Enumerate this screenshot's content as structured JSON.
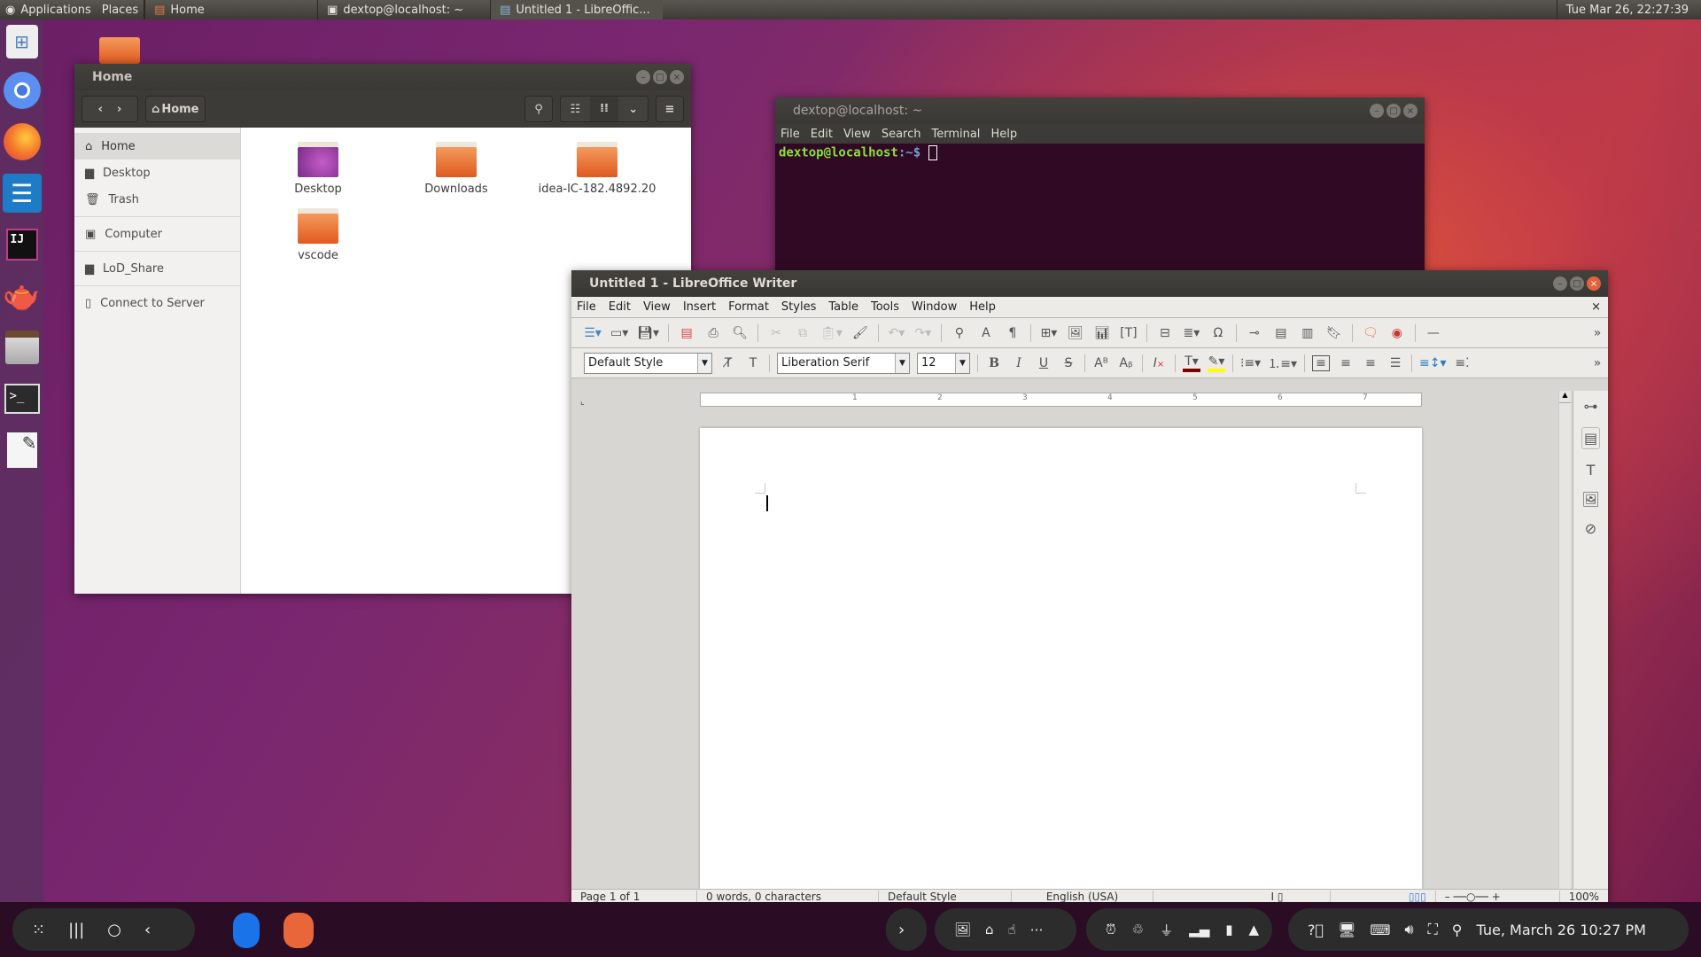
{
  "topbar": {
    "applications": "Applications",
    "places": "Places",
    "tasks": [
      {
        "label": "Home",
        "icon": "file-manager-icon"
      },
      {
        "label": "dextop@localhost: ~",
        "icon": "terminal-icon"
      },
      {
        "label": "Untitled 1 - LibreOffic...",
        "icon": "document-icon"
      }
    ],
    "clock": "Tue Mar 26, 22:27:39"
  },
  "launcher": [
    "software-center",
    "chromium",
    "firefox",
    "libreoffice-writer",
    "intellij-idea",
    "teapot-app",
    "file-cabinet",
    "terminal",
    "text-editor"
  ],
  "nautilus": {
    "title": "Home",
    "path_button": "Home",
    "sidebar": [
      {
        "label": "Home",
        "active": true
      },
      {
        "label": "Desktop"
      },
      {
        "label": "Trash"
      },
      {
        "label": "Computer"
      },
      {
        "label": "LoD_Share"
      },
      {
        "label": "Connect to Server"
      }
    ],
    "files": [
      {
        "name": "Desktop",
        "type": "desktop-folder"
      },
      {
        "name": "Downloads",
        "type": "folder"
      },
      {
        "name": "idea-IC-182.4892.20",
        "type": "folder"
      },
      {
        "name": "vscode",
        "type": "folder"
      }
    ]
  },
  "terminal": {
    "title": "dextop@localhost: ~",
    "menu": [
      "File",
      "Edit",
      "View",
      "Search",
      "Terminal",
      "Help"
    ],
    "prompt_user": "dextop@localhost",
    "prompt_path": ":~$"
  },
  "writer": {
    "title": "Untitled 1 - LibreOffice Writer",
    "menu": [
      "File",
      "Edit",
      "View",
      "Insert",
      "Format",
      "Styles",
      "Table",
      "Tools",
      "Window",
      "Help"
    ],
    "paragraph_style": "Default Style",
    "font_name": "Liberation Serif",
    "font_size": "12",
    "font_color": "#800000",
    "highlight_color": "#ffff00",
    "ruler_marks": [
      "1",
      "2",
      "3",
      "4",
      "5",
      "6",
      "7"
    ],
    "status": {
      "page": "Page 1 of 1",
      "words": "0 words, 0 characters",
      "style": "Default Style",
      "language": "English (USA)",
      "zoom": "100%"
    }
  },
  "bottombar": {
    "datetime": "Tue, March 26 10:27 PM"
  }
}
